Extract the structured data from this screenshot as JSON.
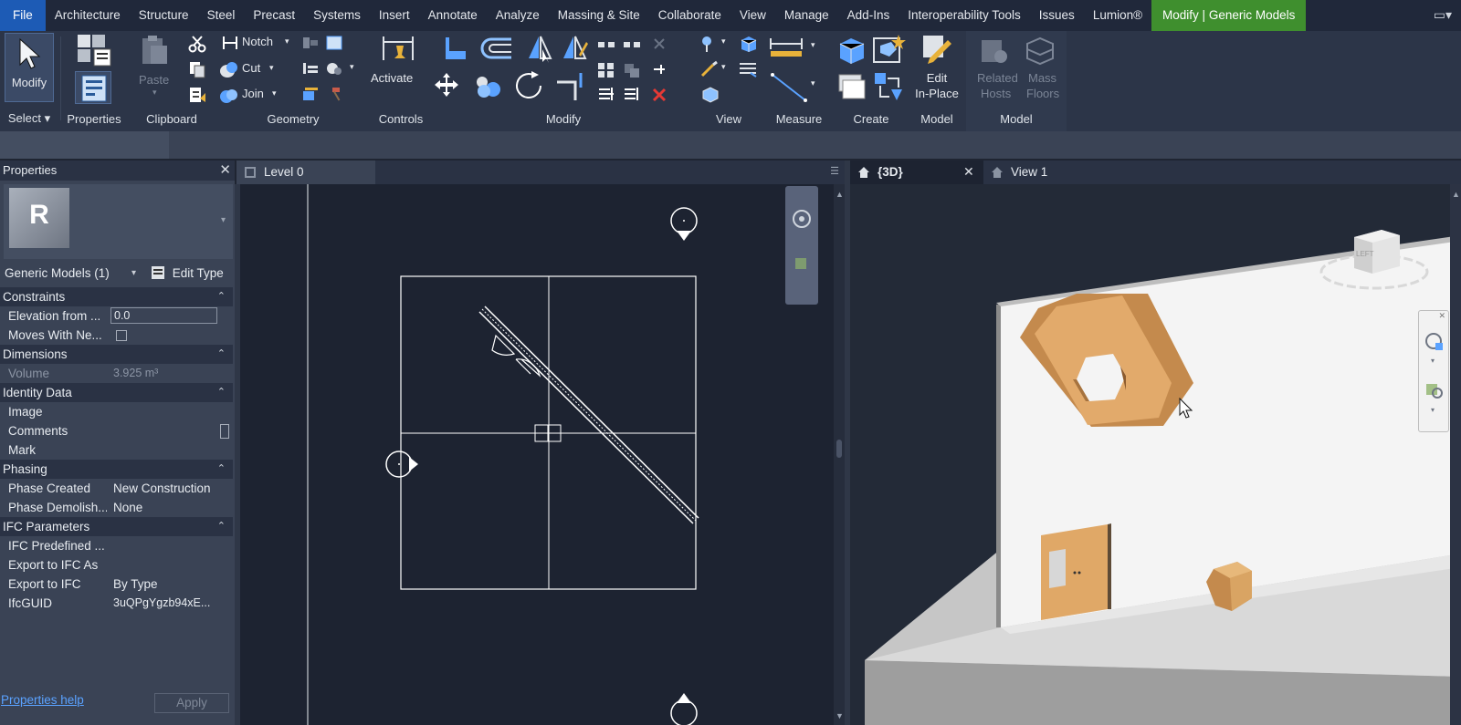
{
  "menu": {
    "tabs": [
      "File",
      "Architecture",
      "Structure",
      "Steel",
      "Precast",
      "Systems",
      "Insert",
      "Annotate",
      "Analyze",
      "Massing & Site",
      "Collaborate",
      "View",
      "Manage",
      "Add-Ins",
      "Interoperability Tools",
      "Issues",
      "Lumion®"
    ],
    "context_tab": "Modify | Generic Models"
  },
  "ribbon": {
    "modify_label": "Modify",
    "select_label": "Select",
    "properties_label": "Properties",
    "paste_label": "Paste",
    "clipboard_label": "Clipboard",
    "notch_label": "Notch",
    "cut_label": "Cut",
    "join_label": "Join",
    "geometry_label": "Geometry",
    "activate_label": "Activate",
    "controls_label": "Controls",
    "modify_group_label": "Modify",
    "view_label": "View",
    "measure_label": "Measure",
    "create_label": "Create",
    "edit_inplace_label_1": "Edit",
    "edit_inplace_label_2": "In-Place",
    "model_label_1": "Model",
    "related_hosts_1": "Related",
    "related_hosts_2": "Hosts",
    "mass_floors_1": "Mass",
    "mass_floors_2": "Floors",
    "model_label_2": "Model"
  },
  "properties": {
    "title": "Properties",
    "type_selector": "Generic Models (1)",
    "edit_type": "Edit Type",
    "sections": {
      "constraints": "Constraints",
      "dimensions": "Dimensions",
      "identity": "Identity Data",
      "phasing": "Phasing",
      "ifc": "IFC Parameters"
    },
    "rows": {
      "elevation_key": "Elevation from ...",
      "elevation_val": "0.0",
      "moves_key": "Moves With Ne...",
      "volume_key": "Volume",
      "volume_val": "3.925 m³",
      "image_key": "Image",
      "comments_key": "Comments",
      "mark_key": "Mark",
      "phase_created_key": "Phase Created",
      "phase_created_val": "New Construction",
      "phase_demolished_key": "Phase Demolish...",
      "phase_demolished_val": "None",
      "ifc_predefined_key": "IFC Predefined ...",
      "export_as_key": "Export to IFC As",
      "export_key": "Export to IFC",
      "export_val": "By Type",
      "ifcguid_key": "IfcGUID",
      "ifcguid_val": "3uQPgYgzb94xE..."
    },
    "help": "Properties help",
    "apply": "Apply"
  },
  "views": {
    "plan_tab": "Level 0",
    "tab_3d": "{3D}",
    "tab_view1": "View 1",
    "viewcube_label": "LEFT"
  },
  "colors": {
    "accent_file": "#1d5bb5",
    "context_green": "#3f8f2e",
    "panel": "#3a4355",
    "canvas": "#1d2331",
    "wood": "#e0a867"
  }
}
